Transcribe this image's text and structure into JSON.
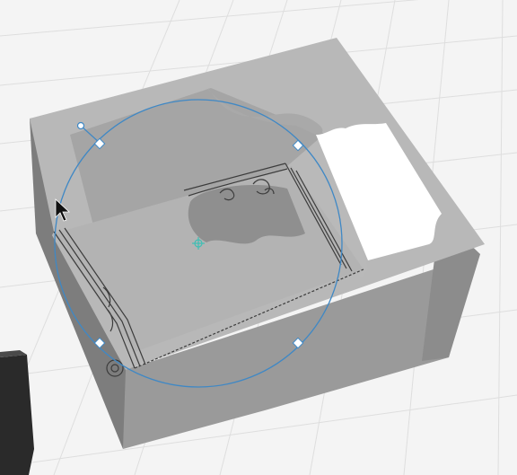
{
  "viewport": {
    "label": "",
    "background": "#f4f4f4",
    "grid_color": "#dedede"
  },
  "model": {
    "kind": "open box with ornamental border interior",
    "colors": {
      "outer_front": "#9a9a9a",
      "outer_right": "#8c8c8c",
      "outer_left": "#7d7d7d",
      "rim": "#b8b8b8",
      "floor": "#b3b3b3",
      "inner_back": "#a7a7a7",
      "inner_right": "#bfbfbf",
      "cutout": "#ffffff",
      "ornament": "#3c3c3c"
    }
  },
  "gizmo": {
    "type": "circular transform handle",
    "color": "#3f88c5",
    "center_color": "#3fbfb4",
    "handles": [
      "handle-ne",
      "handle-nw",
      "handle-sw",
      "handle-se",
      "rotate-handle"
    ]
  },
  "cursor": {
    "icon": "arrow-cursor-icon"
  },
  "side_panel": {
    "color": "#2a2a2a"
  }
}
